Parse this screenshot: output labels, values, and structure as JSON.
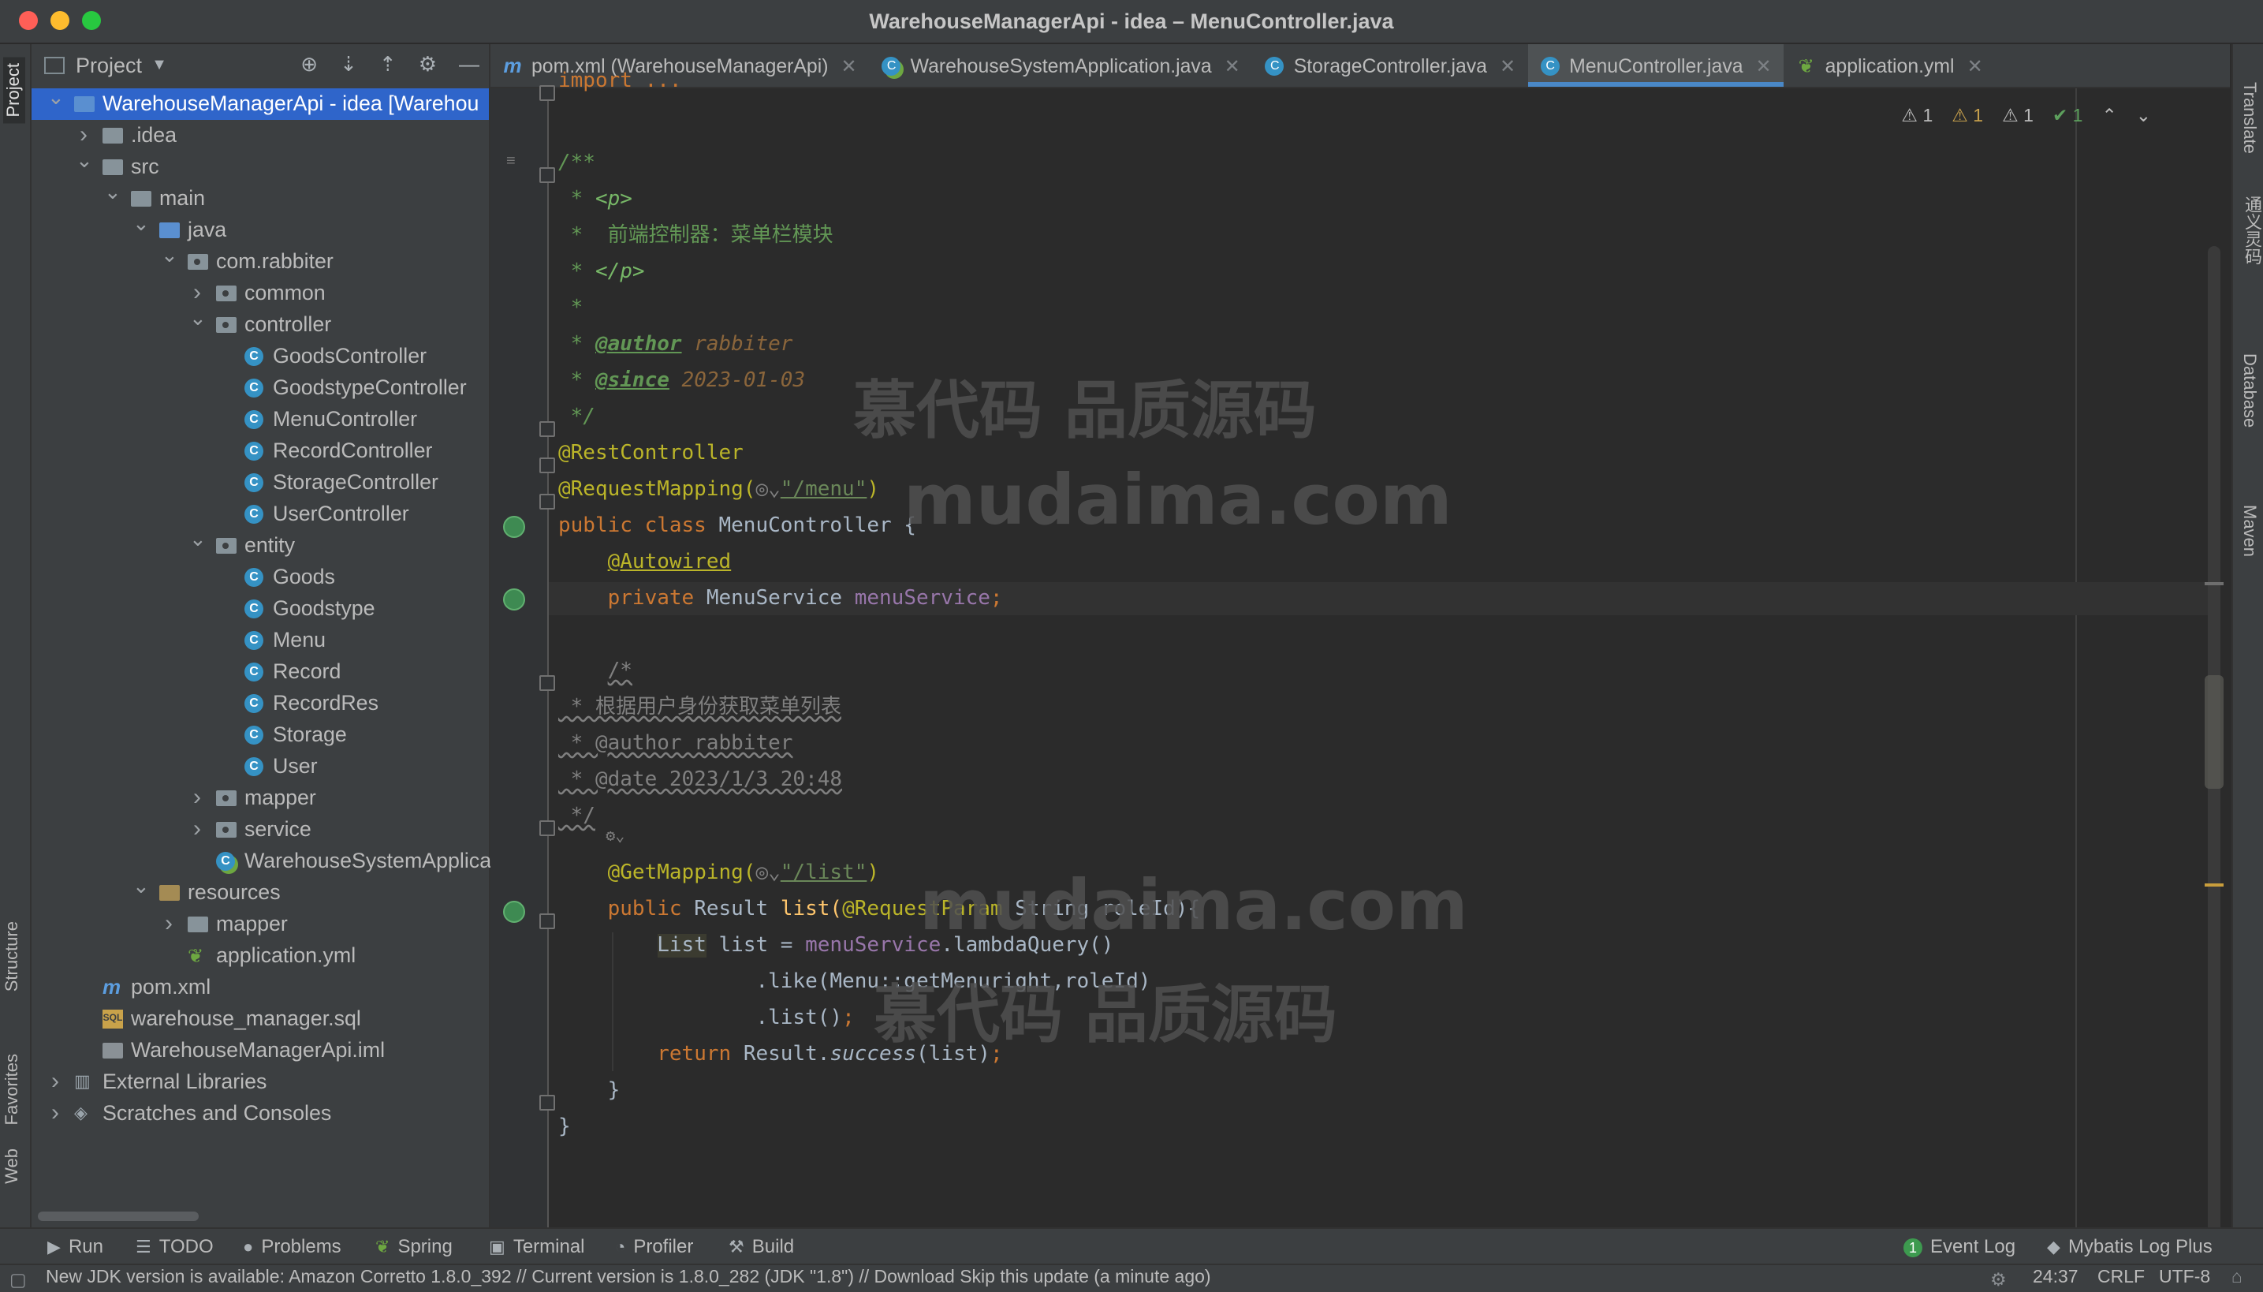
{
  "window": {
    "title": "WarehouseManagerApi - idea – MenuController.java"
  },
  "left_stripe": {
    "project": "Project",
    "structure": "Structure",
    "favorites": "Favorites",
    "web": "Web"
  },
  "project_panel": {
    "title": "Project"
  },
  "tree": [
    {
      "label": "WarehouseManagerApi - idea [Warehou",
      "depth": 0,
      "arrow": "expanded",
      "icon": "module-folder-icon",
      "selected": true
    },
    {
      "label": ".idea",
      "depth": 1,
      "arrow": "collapsed",
      "icon": "folder-icon"
    },
    {
      "label": "src",
      "depth": 1,
      "arrow": "expanded",
      "icon": "folder-icon"
    },
    {
      "label": "main",
      "depth": 2,
      "arrow": "expanded",
      "icon": "folder-icon"
    },
    {
      "label": "java",
      "depth": 3,
      "arrow": "expanded",
      "icon": "source-folder-icon"
    },
    {
      "label": "com.rabbiter",
      "depth": 4,
      "arrow": "expanded",
      "icon": "package-icon"
    },
    {
      "label": "common",
      "depth": 5,
      "arrow": "collapsed",
      "icon": "package-icon"
    },
    {
      "label": "controller",
      "depth": 5,
      "arrow": "expanded",
      "icon": "package-icon"
    },
    {
      "label": "GoodsController",
      "depth": 6,
      "icon": "class-icon"
    },
    {
      "label": "GoodstypeController",
      "depth": 6,
      "icon": "class-icon"
    },
    {
      "label": "MenuController",
      "depth": 6,
      "icon": "class-icon"
    },
    {
      "label": "RecordController",
      "depth": 6,
      "icon": "class-icon"
    },
    {
      "label": "StorageController",
      "depth": 6,
      "icon": "class-icon"
    },
    {
      "label": "UserController",
      "depth": 6,
      "icon": "class-icon"
    },
    {
      "label": "entity",
      "depth": 5,
      "arrow": "expanded",
      "icon": "package-icon"
    },
    {
      "label": "Goods",
      "depth": 6,
      "icon": "class-icon"
    },
    {
      "label": "Goodstype",
      "depth": 6,
      "icon": "class-icon"
    },
    {
      "label": "Menu",
      "depth": 6,
      "icon": "class-icon"
    },
    {
      "label": "Record",
      "depth": 6,
      "icon": "class-icon"
    },
    {
      "label": "RecordRes",
      "depth": 6,
      "icon": "class-icon"
    },
    {
      "label": "Storage",
      "depth": 6,
      "icon": "class-icon"
    },
    {
      "label": "User",
      "depth": 6,
      "icon": "class-icon"
    },
    {
      "label": "mapper",
      "depth": 5,
      "arrow": "collapsed",
      "icon": "package-icon"
    },
    {
      "label": "service",
      "depth": 5,
      "arrow": "collapsed",
      "icon": "package-icon"
    },
    {
      "label": "WarehouseSystemApplica",
      "depth": 5,
      "icon": "spring-class-icon"
    },
    {
      "label": "resources",
      "depth": 3,
      "arrow": "expanded",
      "icon": "resources-folder-icon"
    },
    {
      "label": "mapper",
      "depth": 4,
      "arrow": "collapsed",
      "icon": "folder-icon"
    },
    {
      "label": "application.yml",
      "depth": 4,
      "icon": "yml-icon"
    },
    {
      "label": "pom.xml",
      "depth": 1,
      "icon": "maven-icon"
    },
    {
      "label": "warehouse_manager.sql",
      "depth": 1,
      "icon": "sql-icon"
    },
    {
      "label": "WarehouseManagerApi.iml",
      "depth": 1,
      "icon": "iml-icon"
    },
    {
      "label": "External Libraries",
      "depth": 0,
      "arrow": "collapsed",
      "icon": "library-icon"
    },
    {
      "label": "Scratches and Consoles",
      "depth": 0,
      "arrow": "collapsed",
      "icon": "scratches-icon"
    }
  ],
  "tabs": [
    {
      "label": "pom.xml (WarehouseManagerApi)",
      "icon": "maven-icon",
      "active": false
    },
    {
      "label": "WarehouseSystemApplication.java",
      "icon": "spring-class-icon",
      "active": false
    },
    {
      "label": "StorageController.java",
      "icon": "class-icon",
      "active": false
    },
    {
      "label": "MenuController.java",
      "icon": "class-icon",
      "active": true
    },
    {
      "label": "application.yml",
      "icon": "yml-icon",
      "active": false
    }
  ],
  "inspections": {
    "warn1": "1",
    "warn2": "1",
    "weak": "1",
    "ok": "1"
  },
  "code": {
    "l0": "import ...",
    "l1": "/**",
    "l2a": " * ",
    "l2b": "<p>",
    "l3": " *  前端控制器：菜单栏模块",
    "l4a": " * ",
    "l4b": "</p>",
    "l5": " *",
    "l6a": " * ",
    "l6b": "@author",
    "l6c": " rabbiter",
    "l7a": " * ",
    "l7b": "@since",
    "l7c": " 2023-01-03",
    "l8": " */",
    "l9": "@RestController",
    "l10a": "@RequestMapping(",
    "l10b": "\"/menu\"",
    "l10c": ")",
    "l11a": "public class ",
    "l11b": "MenuController {",
    "l12": "@Autowired",
    "l13a": "private ",
    "l13b": "MenuService ",
    "l13c": "menuService",
    "l13d": ";",
    "l14": "/*",
    "l15": " * 根据用户身份获取菜单列表",
    "l16": " * @author rabbiter",
    "l17": " * @date 2023/1/3 20:48",
    "l18": " */",
    "l19a": "@GetMapping(",
    "l19b": "\"/list\"",
    "l19c": ")",
    "l20a": "public ",
    "l20b": "Result ",
    "l20c": "list(",
    "l20d": "@RequestParam ",
    "l20e": "String roleId){",
    "l21a": "List",
    "l21b": " list = ",
    "l21c": "menuService",
    "l21d": ".lambdaQuery()",
    "l22": ".like(Menu::getMenuright,roleId)",
    "l23a": ".list()",
    "l23b": ";",
    "l24a": "return ",
    "l24b": "Result.",
    "l24c": "success",
    "l24d": "(list)",
    "l24e": ";",
    "l25": "}",
    "l26": "}"
  },
  "watermark": {
    "cn": "慕代码 品质源码",
    "en": "mudaima.com"
  },
  "right_stripe": {
    "translate": "Translate",
    "tongyi": "通义灵码",
    "database": "Database",
    "maven": "Maven"
  },
  "bottom_tools": {
    "run": "Run",
    "todo": "TODO",
    "problems": "Problems",
    "spring": "Spring",
    "terminal": "Terminal",
    "profiler": "Profiler",
    "build": "Build",
    "event_log": "Event Log",
    "event_count": "1",
    "mybatis": "Mybatis Log Plus"
  },
  "status": {
    "message": "New JDK version is available: Amazon Corretto 1.8.0_392 // Current version is 1.8.0_282 (JDK \"1.8\") // Download  Skip this update (a minute ago)",
    "position": "24:37",
    "line_sep": "CRLF",
    "encoding": "UTF-8"
  }
}
